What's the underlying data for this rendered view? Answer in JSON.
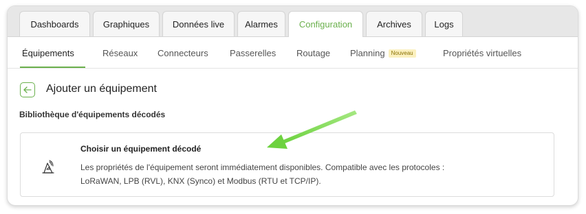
{
  "top_tabs": [
    {
      "label": "Dashboards"
    },
    {
      "label": "Graphiques"
    },
    {
      "label": "Données live"
    },
    {
      "label": "Alarmes"
    },
    {
      "label": "Configuration"
    },
    {
      "label": "Archives"
    },
    {
      "label": "Logs"
    }
  ],
  "active_top_tab": "Configuration",
  "sub_nav": [
    {
      "label": "Équipements"
    },
    {
      "label": "Réseaux"
    },
    {
      "label": "Connecteurs"
    },
    {
      "label": "Passerelles"
    },
    {
      "label": "Routage"
    },
    {
      "label": "Planning",
      "badge": "Nouveau"
    },
    {
      "label": "Propriétés virtuelles"
    }
  ],
  "active_sub_nav": "Équipements",
  "page": {
    "back_icon": "arrow-left-icon",
    "title": "Ajouter un équipement"
  },
  "section": {
    "title": "Bibliothèque d'équipements décodés"
  },
  "option": {
    "icon": "antenna-signal-icon",
    "title": "Choisir un équipement décodé",
    "description_line1": "Les propriétés de l'équipement seront immédiatement disponibles. Compatible avec les protocoles :",
    "description_line2": "LoRaWAN, LPB (RVL), KNX (Synco) et Modbus (RTU et TCP/IP)."
  },
  "colors": {
    "accent": "#6ab04c",
    "annotation_arrow": "#7ed957",
    "badge_bg": "#fbf0bf"
  }
}
